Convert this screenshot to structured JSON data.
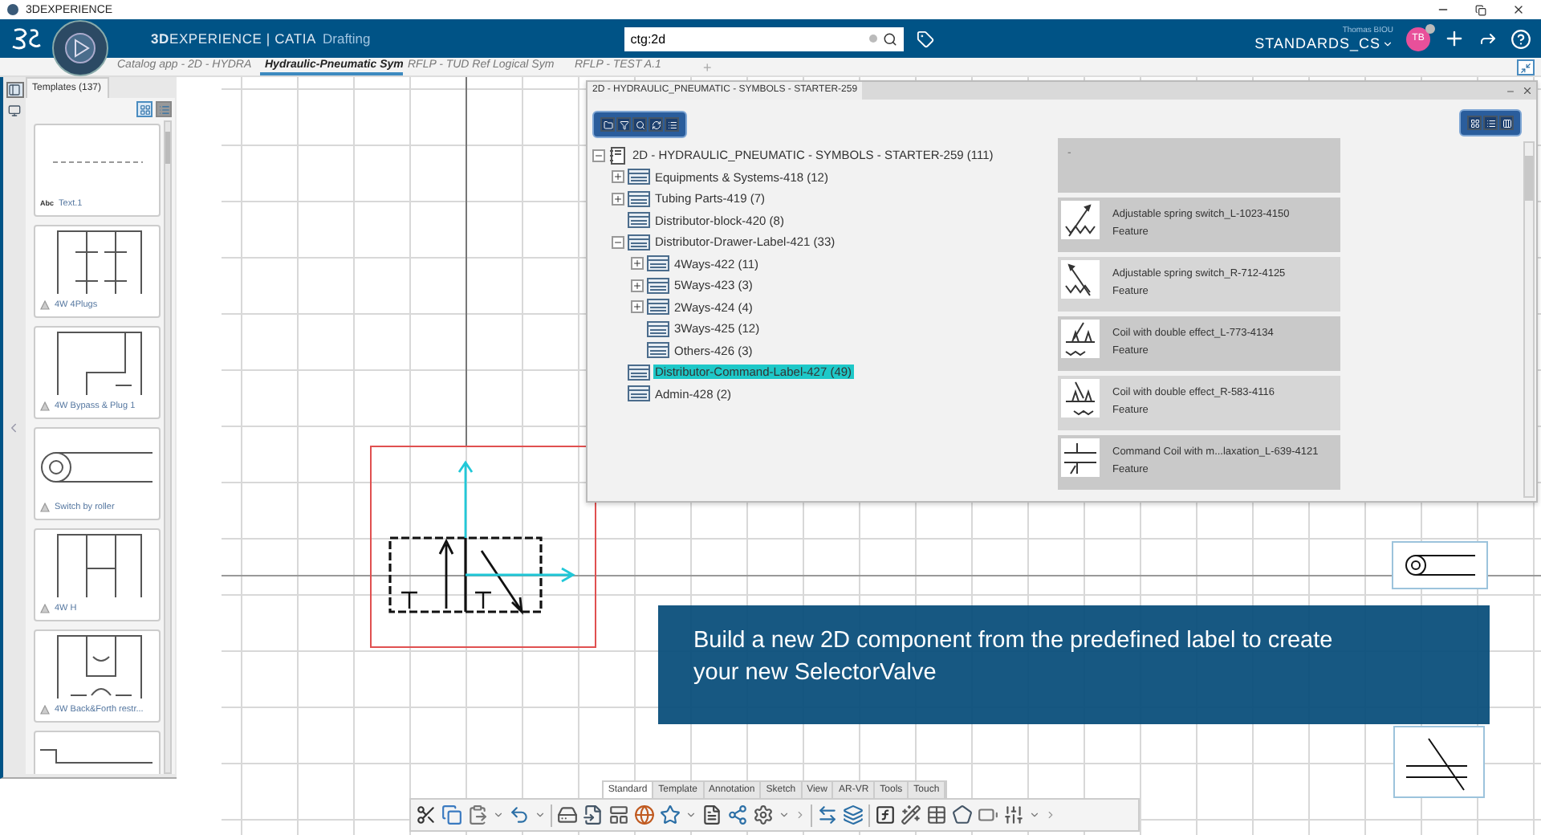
{
  "os_title": "3DEXPERIENCE",
  "header": {
    "brand_strong": "3D",
    "brand_rest": "EXPERIENCE | CATIA",
    "app": "Drafting",
    "search": {
      "value": "ctg:2d"
    },
    "user": "Thomas BIOU",
    "collab_space": "STANDARDS_CS",
    "avatar": "TB"
  },
  "tabs": [
    {
      "label": "Catalog app - 2D - HYDRA",
      "selected": false
    },
    {
      "label": "Hydraulic-Pneumatic Sym",
      "selected": true
    },
    {
      "label": "RFLP - TUD Ref Logical Sym",
      "selected": false
    },
    {
      "label": "RFLP - TEST A.1",
      "selected": false
    }
  ],
  "tab_add": "+",
  "templates_panel": {
    "title": "Templates (137)",
    "items": [
      {
        "kind": "text",
        "badge": "Abc",
        "label": "Text.1"
      },
      {
        "kind": "plugs",
        "label": "4W 4Plugs"
      },
      {
        "kind": "bypass",
        "label": "4W Bypass & Plug 1"
      },
      {
        "kind": "roller",
        "label": "Switch by roller"
      },
      {
        "kind": "h",
        "label": "4W H"
      },
      {
        "kind": "backforth",
        "label": "4W Back&Forth restr..."
      },
      {
        "kind": "partial"
      }
    ]
  },
  "catalog": {
    "title": "2D - HYDRAULIC_PNEUMATIC - SYMBOLS - STARTER-259",
    "tree": {
      "label": "2D - HYDRAULIC_PNEUMATIC - SYMBOLS - STARTER-259 (111)",
      "kind": "catalog",
      "expanded": true,
      "selected": false,
      "children": [
        {
          "label": "Equipments & Systems-418 (12)",
          "expanded": false,
          "selected": false
        },
        {
          "label": "Tubing Parts-419 (7)",
          "expanded": false,
          "selected": false
        },
        {
          "label": "Distributor-block-420 (8)",
          "selected": false
        },
        {
          "label": "Distributor-Drawer-Label-421 (33)",
          "expanded": true,
          "selected": false,
          "children": [
            {
              "label": "4Ways-422 (11)",
              "expanded": false,
              "selected": false
            },
            {
              "label": "5Ways-423 (3)",
              "expanded": false,
              "selected": false
            },
            {
              "label": "2Ways-424 (4)",
              "expanded": false,
              "selected": false
            },
            {
              "label": "3Ways-425 (12)",
              "selected": false
            },
            {
              "label": "Others-426 (3)",
              "selected": false
            }
          ]
        },
        {
          "label": "Distributor-Command-Label-427 (49)",
          "selected": true
        },
        {
          "label": "Admin-428 (2)",
          "selected": false
        }
      ]
    },
    "results": [
      {
        "kind": "blank",
        "name": "-"
      },
      {
        "kind": "spring-left",
        "name": "Adjustable spring switch_L-1023-4150",
        "type": "Feature"
      },
      {
        "kind": "spring-right",
        "name": "Adjustable spring switch_R-712-4125",
        "type": "Feature"
      },
      {
        "kind": "coil-left",
        "name": "Coil with double effect_L-773-4134",
        "type": "Feature"
      },
      {
        "kind": "coil-right",
        "name": "Coil with double effect_R-583-4116",
        "type": "Feature"
      },
      {
        "kind": "command",
        "name": "Command Coil with m...laxation_L-639-4121",
        "type": "Feature"
      }
    ]
  },
  "banner": "Build a new 2D component from the predefined label to create your new SelectorValve",
  "toolbar_tabs": [
    {
      "label": "Standard",
      "selected": true
    },
    {
      "label": "Template",
      "selected": false
    },
    {
      "label": "Annotation",
      "selected": false
    },
    {
      "label": "Sketch",
      "selected": false
    },
    {
      "label": "View",
      "selected": false
    },
    {
      "label": "AR-VR",
      "selected": false
    },
    {
      "label": "Tools",
      "selected": false
    },
    {
      "label": "Touch",
      "selected": false
    }
  ]
}
